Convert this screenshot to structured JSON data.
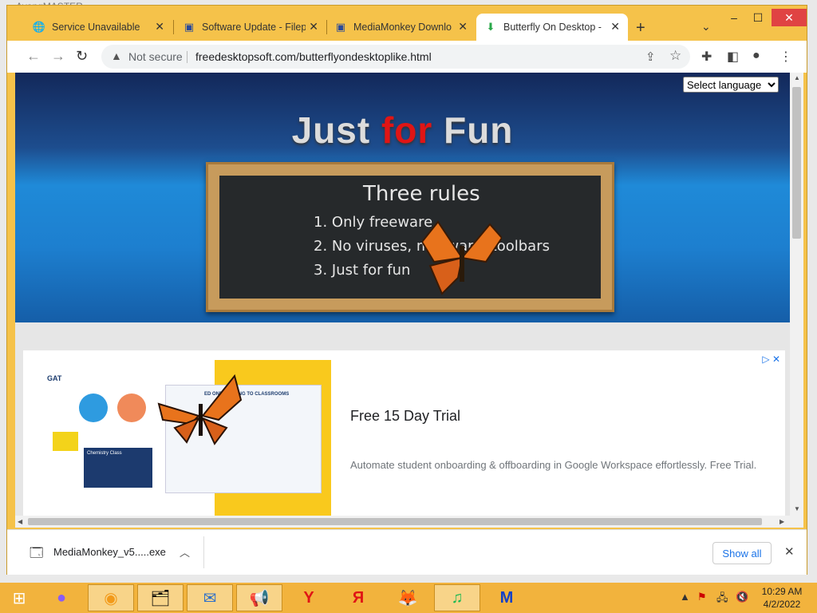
{
  "background_app": {
    "title": "AvangMASTER"
  },
  "tabs": [
    {
      "title": "Service Unavailable",
      "icon": "globe-icon",
      "glyph": "🌐"
    },
    {
      "title": "Software Update - Filep",
      "icon": "software-icon",
      "glyph": "▣"
    },
    {
      "title": "MediaMonkey Downlo",
      "icon": "software-icon",
      "glyph": "▣"
    },
    {
      "title": "Butterfly On Desktop -",
      "icon": "download-icon",
      "glyph": "⬇"
    }
  ],
  "toolbar": {
    "not_secure": "Not secure",
    "url": "freedesktopsoft.com/butterflyondesktoplike.html"
  },
  "page": {
    "select_language": "Select language",
    "hero_title_1": "Just ",
    "hero_title_2": "for",
    "hero_title_3": " Fun",
    "board_heading": "Three rules",
    "rules": [
      "1. Only freeware",
      "2. No viruses, mallware, toolbars",
      "3. Just for fun"
    ]
  },
  "ad": {
    "headline": "Free 15 Day Trial",
    "description": "Automate student onboarding & offboarding in Google Workspace effortlessly. Free Trial.",
    "logo": "GAT",
    "card_title": "ED ONBOARDING TO CLASSROOMS",
    "chem_label": "Chemistry Class"
  },
  "download": {
    "filename": "MediaMonkey_v5.....exe",
    "show_all": "Show all"
  },
  "taskbar": {
    "apps": [
      {
        "icon": "start-icon",
        "glyph": "⊞"
      },
      {
        "icon": "alice-icon",
        "glyph": "●"
      },
      {
        "icon": "chrome-canary-icon",
        "glyph": "◉"
      },
      {
        "icon": "file-explorer-icon",
        "glyph": "🗂"
      },
      {
        "icon": "thunderbird-icon",
        "glyph": "✉"
      },
      {
        "icon": "megaphone-icon",
        "glyph": "📢"
      },
      {
        "icon": "yandex-browser-icon",
        "glyph": "Y"
      },
      {
        "icon": "yandex-icon",
        "glyph": "Я"
      },
      {
        "icon": "firefox-icon",
        "glyph": "🦊"
      },
      {
        "icon": "spotify-icon",
        "glyph": "♫"
      },
      {
        "icon": "malwarebytes-icon",
        "glyph": "M"
      }
    ],
    "time": "10:29 AM",
    "date": "4/2/2022"
  }
}
